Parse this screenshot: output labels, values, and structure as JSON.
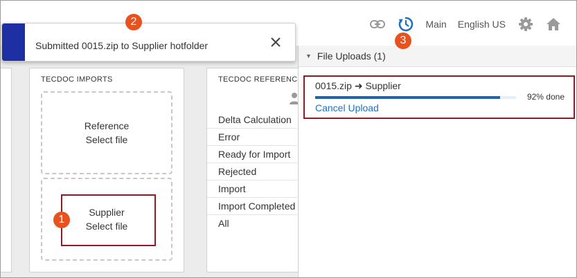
{
  "topnav": {
    "link_icon": "link-icon",
    "refresh_icon": "history-icon",
    "main_label": "Main",
    "language_label": "English US",
    "settings_icon": "gear-icon",
    "home_icon": "home-icon"
  },
  "toast": {
    "message": "Submitted 0015.zip to Supplier hotfolder",
    "accent_color": "#1e2ea3",
    "close_icon": "close-icon"
  },
  "imports_panel": {
    "title": "TECDOC IMPORTS",
    "reference": {
      "title": "Reference",
      "action": "Select file"
    },
    "supplier": {
      "title": "Supplier",
      "action": "Select file"
    }
  },
  "reference_panel": {
    "title": "TECDOC REFERENC",
    "user_icon": "user-icon",
    "statuses": [
      "Delta Calculation",
      "Error",
      "Ready for Import",
      "Rejected",
      "Import",
      "Import Completed",
      "All"
    ]
  },
  "uploads": {
    "header": "File Uploads (1)",
    "item": {
      "name": "0015.zip ➜ Supplier",
      "progress_text": "92% done",
      "progress": 0.92,
      "cancel_label": "Cancel Upload"
    },
    "progress_color": "#1f63b5",
    "link_color": "#1f6fc2"
  },
  "callouts": [
    "1",
    "2",
    "3"
  ],
  "callout_color": "#e8521f",
  "highlight_color": "#8e1b24"
}
